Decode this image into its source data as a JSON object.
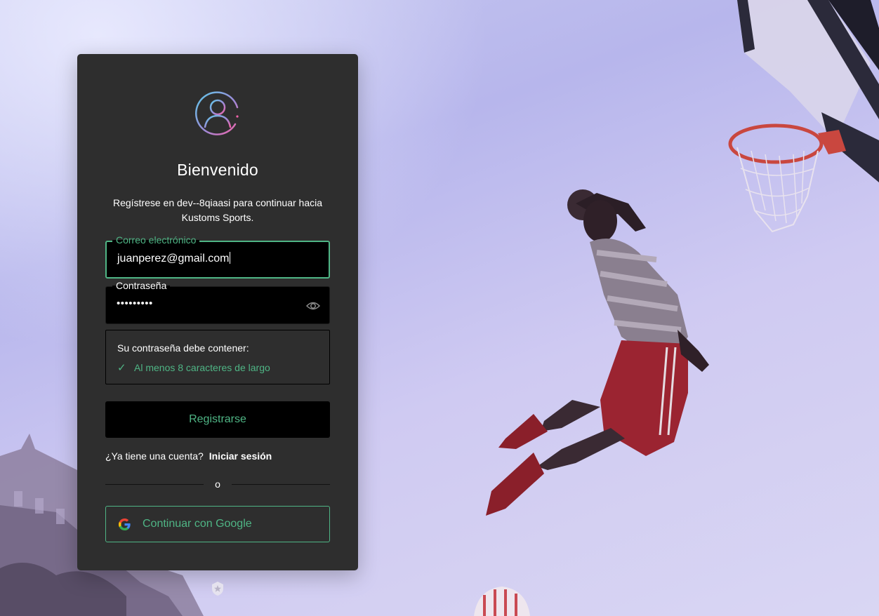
{
  "card": {
    "title": "Bienvenido",
    "subtitle": "Regístrese en dev--8qiaasi para continuar hacia Kustoms Sports."
  },
  "email": {
    "label": "Correo electrónico",
    "value": "juanperez@gmail.com"
  },
  "password": {
    "label": "Contraseña",
    "value": "•••••••••",
    "toggle_icon": "eye-icon"
  },
  "rules": {
    "heading": "Su contraseña debe contener:",
    "items": [
      {
        "icon": "✓",
        "text": "Al menos 8 caracteres de largo"
      }
    ]
  },
  "actions": {
    "submit_label": "Registrarse",
    "have_account": "¿Ya tiene una cuenta?",
    "login_link": "Iniciar sesión",
    "or_label": "o",
    "google_label": "Continuar con Google"
  },
  "colors": {
    "accent": "#4fb585",
    "card_bg": "#2e2e2e",
    "field_bg": "#000000"
  }
}
